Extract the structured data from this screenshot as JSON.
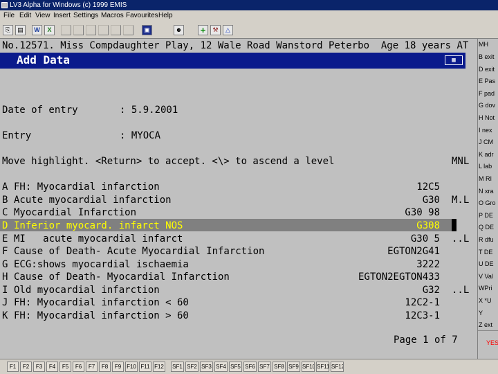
{
  "window": {
    "title": "LV3 Alpha for Windows (c) 1999 EMIS"
  },
  "menu": [
    "File",
    "Edit",
    "View",
    "Insert",
    "Settings",
    "Macros",
    "Favourites",
    "Help"
  ],
  "toolbar": {
    "icons": [
      "clipboard-icon",
      "calendar-icon",
      "word-icon",
      "excel-icon",
      "book-icon",
      "user-search-icon",
      "add-icon",
      "tools-icon",
      "flask-icon"
    ]
  },
  "patient_line": "No.12571. Miss Compdaughter Play, 12 Wale Road Wanstord Peterbo  Age 18 years AT",
  "panel": {
    "title": "Add Data"
  },
  "date_of_entry": {
    "label": "Date of entry",
    "value": ": 5.9.2001"
  },
  "entry": {
    "label": "Entry",
    "value": ": MYOCA"
  },
  "instructions": {
    "text": "Move highlight. <Return> to accept. <\\> to ascend a level",
    "tag": "MNL"
  },
  "results": [
    {
      "letter": "A",
      "term": "FH: Myocardial infarction",
      "code": "12C5",
      "flag": ""
    },
    {
      "letter": "B",
      "term": "Acute myocardial infarction",
      "code": "G30",
      "flag": "M.L"
    },
    {
      "letter": "C",
      "term": "Myocardial Infarction",
      "code": "G30 98",
      "flag": ""
    },
    {
      "letter": "D",
      "term": "Inferior myocard. infarct NOS",
      "code": "G308",
      "flag": ""
    },
    {
      "letter": "E",
      "term": "MI   acute myocardial infarct",
      "code": "G30 5",
      "flag": "..L"
    },
    {
      "letter": "F",
      "term": "Cause of Death- Acute Myocardial Infarction",
      "code": "EGTON2G41",
      "flag": ""
    },
    {
      "letter": "G",
      "term": "ECG:shows myocardial ischaemia",
      "code": "3222",
      "flag": ""
    },
    {
      "letter": "H",
      "term": "Cause of Death- Myocardial Infarction",
      "code": "EGTON2EGTON433",
      "flag": ""
    },
    {
      "letter": "I",
      "term": "Old myocardial infarction",
      "code": "G32",
      "flag": "..L"
    },
    {
      "letter": "J",
      "term": "FH: Myocardial infarction < 60",
      "code": "12C2-1",
      "flag": ""
    },
    {
      "letter": "K",
      "term": "FH: Myocardial infarction > 60",
      "code": "12C3-1",
      "flag": ""
    }
  ],
  "pager": "Page 1 of 7",
  "sidebar": {
    "header": "MH",
    "items": [
      "B exit",
      "D exit",
      "E Pas",
      "F pad",
      "G dov",
      "H Not",
      "I nex",
      "J CM",
      "K adr",
      "L lab",
      "M RI",
      "N xra",
      "O Gro",
      "P DE",
      "Q DE",
      "R dfu",
      "T DE",
      "U DE",
      "V Val",
      "WPri",
      "X *U",
      "Y",
      "Z ext"
    ],
    "yes": "YES"
  },
  "fkeys": [
    "F1",
    "F2",
    "F3",
    "F4",
    "F5",
    "F6",
    "F7",
    "F8",
    "F9",
    "F10",
    "F11",
    "F12",
    "SF1",
    "SF2",
    "SF3",
    "SF4",
    "SF5",
    "SF6",
    "SF7",
    "SF8",
    "SF9",
    "SF10",
    "SF11",
    "SF12"
  ],
  "colors": {
    "highlight_bg": "#808080",
    "highlight_text": "#ffff00",
    "banner": "#0a1a8c",
    "title": "#0a246a"
  }
}
